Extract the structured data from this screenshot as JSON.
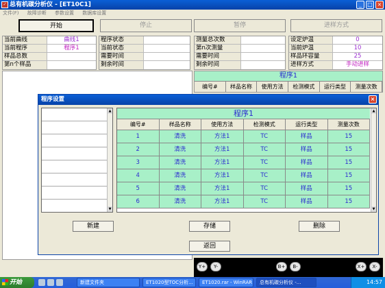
{
  "window": {
    "title": "总有机碳分析仪 - [ET10C1]"
  },
  "menu": [
    "文件(F)",
    "故障诊断",
    "参数设置",
    "数据库设置"
  ],
  "toolbar": {
    "start": "开始",
    "stop": "停止",
    "pause": "暂停",
    "mode": "进样方式"
  },
  "status_left": [
    {
      "label": "当前曲线",
      "value": "曲线1"
    },
    {
      "label": "当前程序",
      "value": "程序1"
    },
    {
      "label": "样品总数",
      "value": ""
    },
    {
      "label": "第n个样品",
      "value": ""
    }
  ],
  "status_mid": [
    {
      "label": "程序状态",
      "value": ""
    },
    {
      "label": "当前状态",
      "value": ""
    },
    {
      "label": "需要时间",
      "value": ""
    },
    {
      "label": "剩余时间",
      "value": ""
    }
  ],
  "status_mid2": [
    {
      "label": "测量总次数",
      "value": ""
    },
    {
      "label": "第n次测量",
      "value": ""
    },
    {
      "label": "需要时间",
      "value": ""
    },
    {
      "label": "剩余时间",
      "value": ""
    }
  ],
  "status_right": [
    {
      "label": "设定炉温",
      "value": "0"
    },
    {
      "label": "当前炉温",
      "value": "10"
    },
    {
      "label": "样品环容量",
      "value": "25"
    },
    {
      "label": "进样方式",
      "value": "手动进样"
    }
  ],
  "right_panel": {
    "title": "程序1",
    "headers": [
      "编号#",
      "样品名称",
      "使用方法",
      "检测模式",
      "运行类型",
      "测量次数"
    ]
  },
  "graph_buttons": [
    "Y+",
    "Y-",
    "B+",
    "B-",
    "X+",
    "X-"
  ],
  "left_bottom_text": "",
  "dialog": {
    "title": "程序设置",
    "table_title": "程序1",
    "headers": [
      "编号#",
      "样品名称",
      "使用方法",
      "检测模式",
      "运行类型",
      "测量次数"
    ],
    "rows": [
      [
        "1",
        "清洗",
        "方法1",
        "TC",
        "样品",
        "15"
      ],
      [
        "2",
        "清洗",
        "方法1",
        "TC",
        "样品",
        "15"
      ],
      [
        "3",
        "清洗",
        "方法1",
        "TC",
        "样品",
        "15"
      ],
      [
        "4",
        "清洗",
        "方法1",
        "TC",
        "样品",
        "15"
      ],
      [
        "5",
        "清洗",
        "方法1",
        "TC",
        "样品",
        "15"
      ],
      [
        "6",
        "清洗",
        "方法1",
        "TC",
        "样品",
        "15"
      ]
    ],
    "buttons": {
      "new": "新建",
      "save": "存储",
      "delete": "删除",
      "back": "返回"
    }
  },
  "taskbar": {
    "start": "开始",
    "tasks": [
      "新建文件夹",
      "ET1020型TOC分析...",
      "ET1020.rar - WinRAR",
      "总有机碳分析仪 -..."
    ],
    "time": "14:57"
  }
}
